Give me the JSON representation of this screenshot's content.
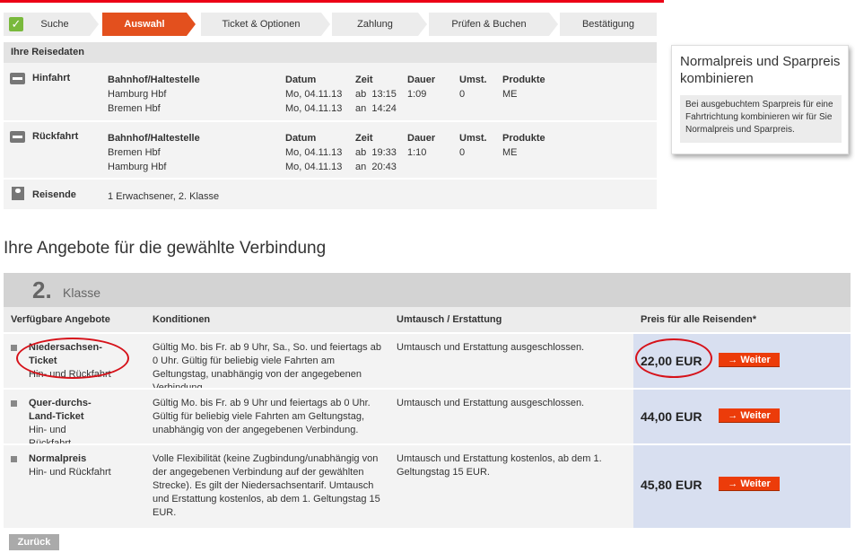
{
  "steps": [
    "Suche",
    "Auswahl",
    "Ticket & Optionen",
    "Zahlung",
    "Prüfen & Buchen",
    "Bestätigung"
  ],
  "reisedaten": {
    "title": "Ihre Reisedaten",
    "headers": {
      "station": "Bahnhof/Haltestelle",
      "date": "Datum",
      "time": "Zeit",
      "duration": "Dauer",
      "changes": "Umst.",
      "products": "Produkte"
    },
    "hinfahrt": {
      "label": "Hinfahrt",
      "from": "Hamburg Hbf",
      "to": "Bremen Hbf",
      "date_from": "Mo, 04.11.13",
      "date_to": "Mo, 04.11.13",
      "dep_prefix": "ab",
      "dep_time": "13:15",
      "arr_prefix": "an",
      "arr_time": "14:24",
      "duration": "1:09",
      "changes": "0",
      "products": "ME"
    },
    "rueckfahrt": {
      "label": "Rückfahrt",
      "from": "Bremen Hbf",
      "to": "Hamburg Hbf",
      "date_from": "Mo, 04.11.13",
      "date_to": "Mo, 04.11.13",
      "dep_prefix": "ab",
      "dep_time": "19:33",
      "arr_prefix": "an",
      "arr_time": "20:43",
      "duration": "1:10",
      "changes": "0",
      "products": "ME"
    },
    "reisende": {
      "label": "Reisende",
      "value": "1 Erwachsener, 2. Klasse"
    }
  },
  "info": {
    "title": "Normalpreis und Sparpreis kombinieren",
    "text": "Bei ausgebuchtem Sparpreis für eine Fahrtrichtung kombinieren wir für Sie Normalpreis und Sparpreis."
  },
  "offers": {
    "title": "Ihre Angebote für die gewählte Verbindung",
    "class_num": "2.",
    "class_label": "Klasse",
    "headers": {
      "offer": "Verfügbare Angebote",
      "cond": "Konditionen",
      "exchange": "Umtausch / Erstattung",
      "price": "Preis für alle Reisenden*"
    },
    "rows": [
      {
        "name": "Niedersachsen-Ticket",
        "sub": "Hin- und Rückfahrt",
        "cond": "Gültig Mo. bis Fr. ab 9 Uhr, Sa., So. und feiertags ab 0 Uhr. Gültig für beliebig viele Fahrten am Geltungstag, unabhängig von der angegebenen Verbindung.",
        "exchange": "Umtausch und Erstattung ausgeschlossen.",
        "price": "22,00 EUR",
        "button": "Weiter"
      },
      {
        "name": "Quer-durchs-Land-Ticket",
        "sub": "Hin- und Rückfahrt",
        "cond": "Gültig Mo. bis Fr. ab 9 Uhr und feiertags ab 0 Uhr. Gültig für beliebig viele Fahrten am Geltungstag, unabhängig von der angegebenen Verbindung.",
        "exchange": "Umtausch und Erstattung ausgeschlossen.",
        "price": "44,00 EUR",
        "button": "Weiter"
      },
      {
        "name": "Normalpreis",
        "sub": "Hin- und Rückfahrt",
        "cond": "Volle Flexibilität (keine Zugbindung/unabhängig von der angegebenen Verbindung auf der gewählten Strecke). Es gilt der Niedersachsentarif. Umtausch und Erstattung kostenlos, ab dem 1. Geltungstag 15 EUR.",
        "exchange": "Umtausch und Erstattung kostenlos, ab dem 1. Geltungstag 15 EUR.",
        "price": "45,80 EUR",
        "button": "Weiter"
      }
    ]
  },
  "back_button": "Zurück"
}
